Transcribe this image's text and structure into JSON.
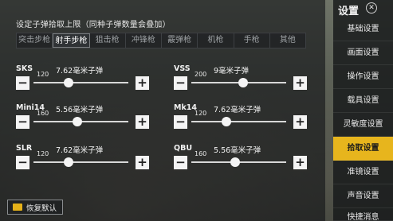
{
  "panel": {
    "title": "设定子弹拾取上限（同种子弹数量会叠加）",
    "tabs": [
      {
        "label": "突击步枪",
        "active": false
      },
      {
        "label": "射手步枪",
        "active": true
      },
      {
        "label": "狙击枪",
        "active": false
      },
      {
        "label": "冲锋枪",
        "active": false
      },
      {
        "label": "霰弹枪",
        "active": false
      },
      {
        "label": "机枪",
        "active": false
      },
      {
        "label": "手枪",
        "active": false
      },
      {
        "label": "其他",
        "active": false
      }
    ],
    "weapons": [
      {
        "name": "SKS",
        "ammo": "7.62毫米子弹",
        "value": "120",
        "level": 0.37
      },
      {
        "name": "VSS",
        "ammo": "9毫米子弹",
        "value": "200",
        "level": 0.55
      },
      {
        "name": "Mini14",
        "ammo": "5.56毫米子弹",
        "value": "160",
        "level": 0.46
      },
      {
        "name": "Mk14",
        "ammo": "7.62毫米子弹",
        "value": "120",
        "level": 0.37
      },
      {
        "name": "SLR",
        "ammo": "7.62毫米子弹",
        "value": "120",
        "level": 0.37
      },
      {
        "name": "QBU",
        "ammo": "5.56毫米子弹",
        "value": "160",
        "level": 0.46
      }
    ],
    "reset_label": "恢复默认"
  },
  "sidebar": {
    "title": "设置",
    "items": [
      {
        "label": "基础设置",
        "active": false
      },
      {
        "label": "画面设置",
        "active": false
      },
      {
        "label": "操作设置",
        "active": false
      },
      {
        "label": "载具设置",
        "active": false
      },
      {
        "label": "灵敏度设置",
        "active": false
      },
      {
        "label": "拾取设置",
        "active": true
      },
      {
        "label": "准镜设置",
        "active": false
      },
      {
        "label": "声音设置",
        "active": false
      },
      {
        "label": "快捷消息",
        "active": false
      }
    ]
  },
  "icons": {
    "minus": "minus-icon",
    "plus": "plus-icon",
    "reset": "reset-icon",
    "close": "close-icon"
  },
  "colors": {
    "accent": "#e7b51d",
    "button": "#f4f4f4"
  }
}
